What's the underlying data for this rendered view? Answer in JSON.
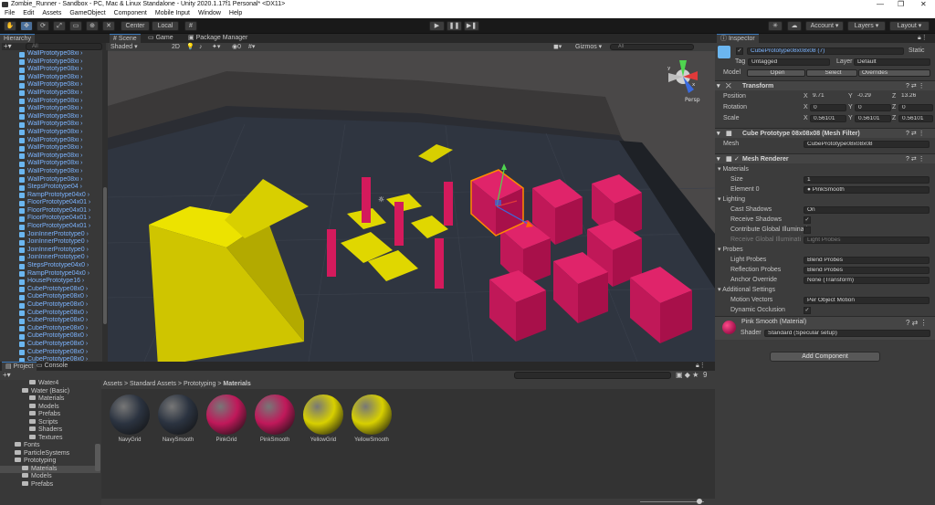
{
  "window": {
    "title": "Zombie_Runner - Sandbox - PC, Mac & Linux Standalone - Unity 2020.1.17f1 Personal* <DX11>"
  },
  "menu": [
    "File",
    "Edit",
    "Assets",
    "GameObject",
    "Component",
    "Mobile Input",
    "Window",
    "Help"
  ],
  "toolbar": {
    "pivot": "Center",
    "space": "Local",
    "account": "Account",
    "layers": "Layers",
    "layout": "Layout"
  },
  "hierarchy": {
    "title": "Hierarchy",
    "search_placeholder": "All",
    "items": [
      "WallPrototype08xi",
      "WallPrototype08xi",
      "WallPrototype08xi",
      "WallPrototype08xi",
      "WallPrototype08xi",
      "WallPrototype08xi",
      "WallPrototype08xi",
      "WallPrototype08xi",
      "WallPrototype08xi",
      "WallPrototype08xi",
      "WallPrototype08xi",
      "WallPrototype08xi",
      "WallPrototype08xi",
      "WallPrototype08xi",
      "WallPrototype08xi",
      "WallPrototype08xi",
      "WallPrototype08xi",
      "StepsPrototype04",
      "RampPrototype04x0",
      "FloorPrototype04x01",
      "FloorPrototype04x01",
      "FloorPrototype04x01",
      "FloorPrototype04x01",
      "JoinInnerPrototype0",
      "JoinInnerPrototype0",
      "JoinInnerPrototype0",
      "JoinInnerPrototype0",
      "StepsPrototype04x0",
      "RampPrototype04x0",
      "HousePrototype16",
      "CubePrototype08x0",
      "CubePrototype08x0",
      "CubePrototype08x0",
      "CubePrototype08x0",
      "CubePrototype08x0",
      "CubePrototype08x0",
      "CubePrototype08x0",
      "CubePrototype08x0",
      "CubePrototype08x0",
      "CubePrototype08x0"
    ]
  },
  "scene": {
    "tabs": [
      "Scene",
      "Game",
      "Package Manager"
    ],
    "shading": "Shaded",
    "mode2d": "2D",
    "gizmos": "Gizmos",
    "search_placeholder": "All",
    "persp": "Persp"
  },
  "inspector": {
    "title": "Inspector",
    "object_name": "CubePrototype08x08x08 (7)",
    "static_label": "Static",
    "tag_label": "Tag",
    "tag_value": "Untagged",
    "layer_label": "Layer",
    "layer_value": "Default",
    "model_label": "Model",
    "open": "Open",
    "select": "Select",
    "overrides": "Overrides",
    "transform": {
      "title": "Transform",
      "position_label": "Position",
      "position": [
        "9.71",
        "-0.29",
        "13.26"
      ],
      "rotation_label": "Rotation",
      "rotation": [
        "0",
        "0",
        "0"
      ],
      "scale_label": "Scale",
      "scale": [
        "0.56101",
        "0.56101",
        "0.56101"
      ]
    },
    "mesh_filter": {
      "title": "Cube Prototype 08x08x08 (Mesh Filter)",
      "mesh_label": "Mesh",
      "mesh_value": "CubePrototype08x08x08"
    },
    "mesh_renderer": {
      "title": "Mesh Renderer",
      "materials_label": "Materials",
      "size_label": "Size",
      "size_value": "1",
      "element_label": "Element 0",
      "element_value": "PinkSmooth",
      "lighting_label": "Lighting",
      "cast_shadows_label": "Cast Shadows",
      "cast_shadows_value": "On",
      "receive_shadows_label": "Receive Shadows",
      "contribute_gi_label": "Contribute Global Illuminati",
      "receive_gi_label": "Receive Global Illuminati",
      "receive_gi_value": "Light Probes",
      "probes_label": "Probes",
      "light_probes_label": "Light Probes",
      "light_probes_value": "Blend Probes",
      "reflection_probes_label": "Reflection Probes",
      "reflection_probes_value": "Blend Probes",
      "anchor_override_label": "Anchor Override",
      "anchor_override_value": "None (Transform)",
      "additional_label": "Additional Settings",
      "motion_vectors_label": "Motion Vectors",
      "motion_vectors_value": "Per Object Motion",
      "dynamic_occlusion_label": "Dynamic Occlusion"
    },
    "material": {
      "title": "Pink Smooth (Material)",
      "shader_label": "Shader",
      "shader_value": "Standard (Specular setup)"
    },
    "add_component": "Add Component"
  },
  "project": {
    "tabs": [
      "Project",
      "Console"
    ],
    "breadcrumb": [
      "Assets",
      "Standard Assets",
      "Prototyping",
      "Materials"
    ],
    "tree": [
      {
        "label": "Water4",
        "indent": 3
      },
      {
        "label": "Water (Basic)",
        "indent": 2
      },
      {
        "label": "Materials",
        "indent": 3
      },
      {
        "label": "Models",
        "indent": 3
      },
      {
        "label": "Prefabs",
        "indent": 3
      },
      {
        "label": "Scripts",
        "indent": 3
      },
      {
        "label": "Shaders",
        "indent": 3
      },
      {
        "label": "Textures",
        "indent": 3
      },
      {
        "label": "Fonts",
        "indent": 1
      },
      {
        "label": "ParticleSystems",
        "indent": 1
      },
      {
        "label": "Prototyping",
        "indent": 1
      },
      {
        "label": "Materials",
        "indent": 2
      },
      {
        "label": "Models",
        "indent": 2
      },
      {
        "label": "Prefabs",
        "indent": 2
      }
    ],
    "assets": [
      {
        "name": "NavyGrid",
        "color": "#2b3340"
      },
      {
        "name": "NavySmooth",
        "color": "#2b3340"
      },
      {
        "name": "PinkGrid",
        "color": "#c0185a"
      },
      {
        "name": "PinkSmooth",
        "color": "#c0185a"
      },
      {
        "name": "YellowGrid",
        "color": "#d8d000"
      },
      {
        "name": "YellowSmooth",
        "color": "#d8d000"
      }
    ],
    "badge": "9"
  },
  "colors": {
    "accent": "#3a79bb",
    "pink": "#d41a5c",
    "yellow": "#e6de00",
    "floor": "#2f3540"
  }
}
